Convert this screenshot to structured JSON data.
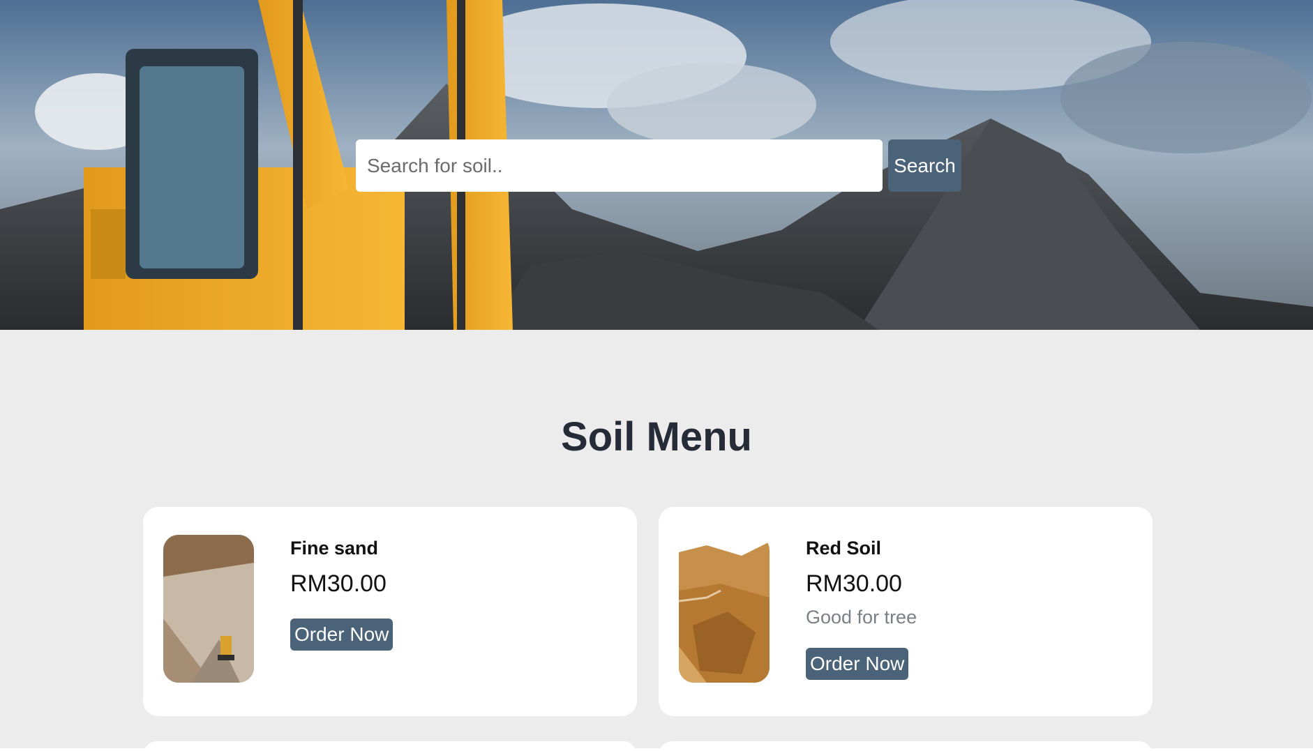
{
  "search": {
    "placeholder": "Search for soil..",
    "button_label": "Search"
  },
  "menu": {
    "title": "Soil Menu",
    "items": [
      {
        "name": "Fine sand",
        "price": "RM30.00",
        "description": "",
        "button_label": "Order Now",
        "image_icon": "fine-sand-photo"
      },
      {
        "name": "Red Soil",
        "price": "RM30.00",
        "description": "Good for tree",
        "button_label": "Order Now",
        "image_icon": "red-soil-photo"
      }
    ]
  },
  "colors": {
    "accent": "#4a6379",
    "title": "#252c38",
    "section_bg": "#ececec",
    "muted_text": "#7a7f86"
  }
}
